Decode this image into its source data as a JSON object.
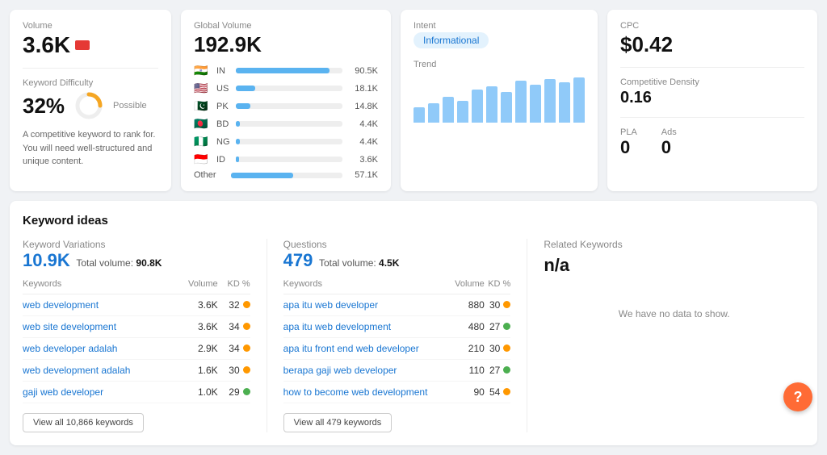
{
  "volume": {
    "label": "Volume",
    "value": "3.6K"
  },
  "keyword_difficulty": {
    "label": "Keyword Difficulty",
    "percent": "32%",
    "badge": "Possible",
    "desc": "A competitive keyword to rank for. You will need well-structured and unique content.",
    "donut_value": 32
  },
  "global_volume": {
    "label": "Global Volume",
    "value": "192.9K",
    "countries": [
      {
        "flag": "🇮🇳",
        "code": "IN",
        "value": "90.5K",
        "bar_pct": 88
      },
      {
        "flag": "🇺🇸",
        "code": "US",
        "value": "18.1K",
        "bar_pct": 18
      },
      {
        "flag": "🇵🇰",
        "code": "PK",
        "value": "14.8K",
        "bar_pct": 14
      },
      {
        "flag": "🇧🇩",
        "code": "BD",
        "value": "4.4K",
        "bar_pct": 4
      },
      {
        "flag": "🇳🇬",
        "code": "NG",
        "value": "4.4K",
        "bar_pct": 4
      },
      {
        "flag": "🇮🇩",
        "code": "ID",
        "value": "3.6K",
        "bar_pct": 3
      }
    ],
    "other_label": "Other",
    "other_value": "57.1K",
    "other_bar_pct": 56
  },
  "intent": {
    "label": "Intent",
    "badge": "Informational",
    "trend_label": "Trend",
    "trend_bars": [
      18,
      22,
      30,
      25,
      38,
      42,
      35,
      48,
      44,
      50,
      46,
      52
    ]
  },
  "cpc": {
    "label": "CPC",
    "value": "$0.42",
    "comp_label": "Competitive Density",
    "comp_value": "0.16",
    "pla_label": "PLA",
    "pla_value": "0",
    "ads_label": "Ads",
    "ads_value": "0"
  },
  "keyword_ideas": {
    "section_title": "Keyword ideas",
    "variations": {
      "title": "Keyword Variations",
      "count": "10.9K",
      "total_label": "Total volume:",
      "total_value": "90.8K",
      "col_kw": "Keywords",
      "col_vol": "Volume",
      "col_kd": "KD %",
      "rows": [
        {
          "kw": "web development",
          "vol": "3.6K",
          "kd": 32,
          "dot": "orange"
        },
        {
          "kw": "web site development",
          "vol": "3.6K",
          "kd": 34,
          "dot": "orange"
        },
        {
          "kw": "web developer adalah",
          "vol": "2.9K",
          "kd": 34,
          "dot": "orange"
        },
        {
          "kw": "web development adalah",
          "vol": "1.6K",
          "kd": 30,
          "dot": "orange"
        },
        {
          "kw": "gaji web developer",
          "vol": "1.0K",
          "kd": 29,
          "dot": "green"
        }
      ],
      "btn": "View all 10,866 keywords"
    },
    "questions": {
      "title": "Questions",
      "count": "479",
      "total_label": "Total volume:",
      "total_value": "4.5K",
      "col_kw": "Keywords",
      "col_vol": "Volume",
      "col_kd": "KD %",
      "rows": [
        {
          "kw": "apa itu web developer",
          "vol": "880",
          "kd": 30,
          "dot": "orange"
        },
        {
          "kw": "apa itu web development",
          "vol": "480",
          "kd": 27,
          "dot": "green"
        },
        {
          "kw": "apa itu front end web developer",
          "vol": "210",
          "kd": 30,
          "dot": "orange"
        },
        {
          "kw": "berapa gaji web developer",
          "vol": "110",
          "kd": 27,
          "dot": "green"
        },
        {
          "kw": "how to become web development",
          "vol": "90",
          "kd": 54,
          "dot": "orange"
        }
      ],
      "btn": "View all 479 keywords"
    },
    "related": {
      "title": "Related Keywords",
      "value": "n/a",
      "no_data": "We have no data to show."
    }
  },
  "help_btn": "?"
}
